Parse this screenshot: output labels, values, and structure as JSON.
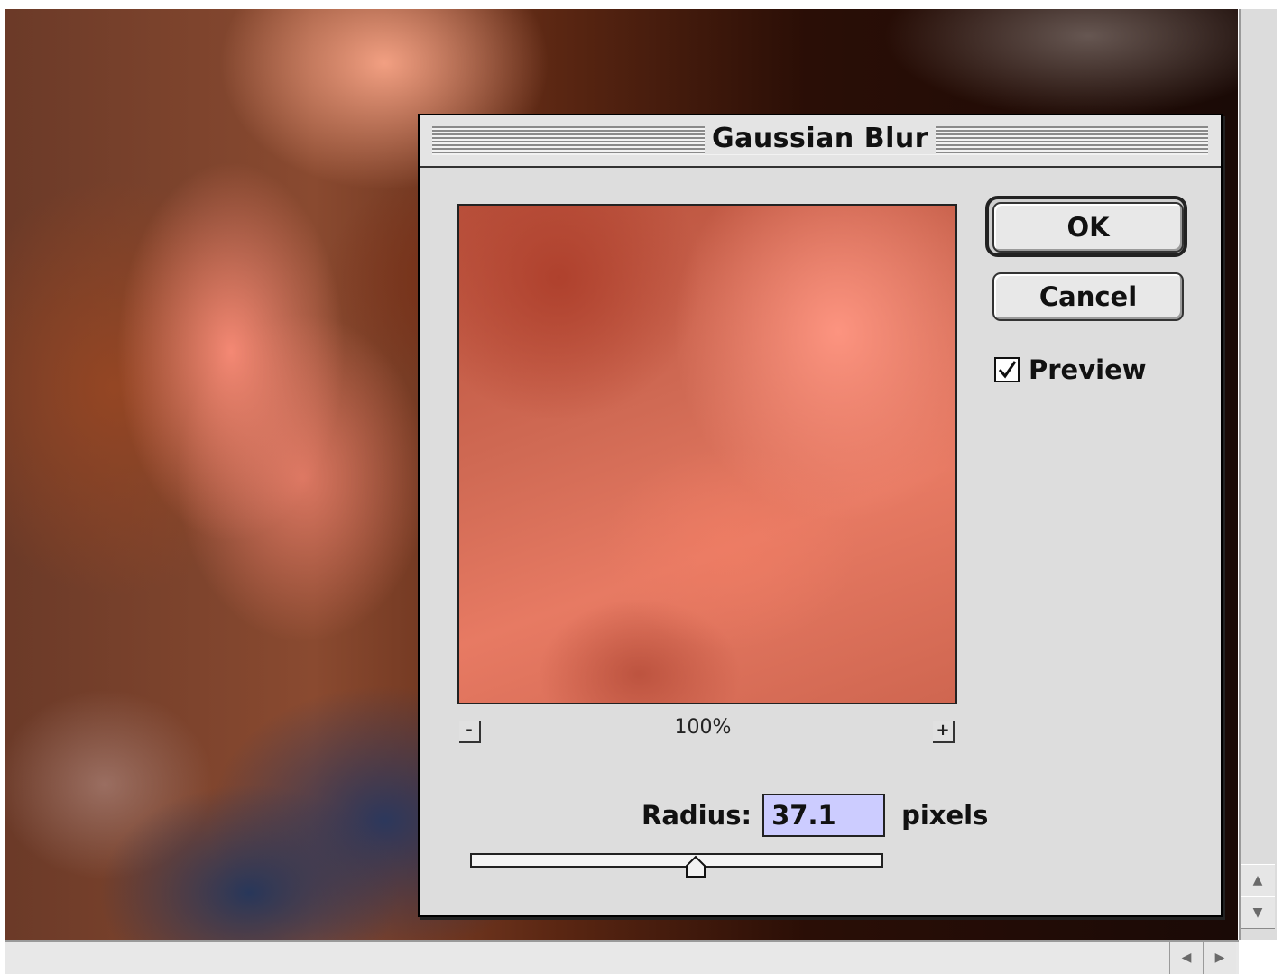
{
  "dialog": {
    "title": "Gaussian Blur",
    "ok_label": "OK",
    "cancel_label": "Cancel",
    "preview_label": "Preview",
    "preview_checked": true,
    "zoom_out": "-",
    "zoom_in": "+",
    "zoom_level": "100%",
    "radius_label": "Radius:",
    "radius_value": "37.1",
    "radius_unit": "pixels",
    "slider_fraction": 0.55
  },
  "window": {
    "vscroll_up": "▲",
    "vscroll_down": "▼",
    "hscroll_left": "◀",
    "hscroll_right": "▶"
  },
  "colors": {
    "dialog_bg": "#dddddd",
    "field_bg": "#ccccff"
  }
}
